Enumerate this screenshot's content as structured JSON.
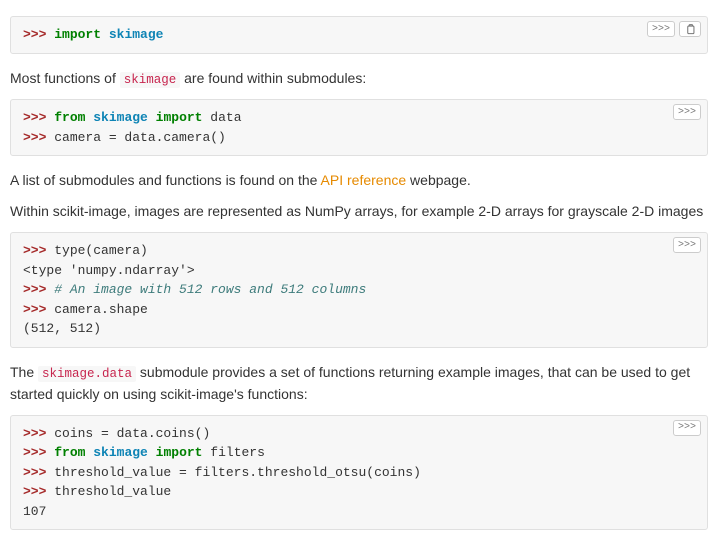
{
  "blocks": {
    "b1": {
      "l1_prompt": ">>> ",
      "l1_kw": "import",
      "l1_sp": " ",
      "l1_mod": "skimage"
    },
    "b2": {
      "l1_prompt": ">>> ",
      "l1_kw1": "from",
      "l1_sp1": " ",
      "l1_mod": "skimage",
      "l1_sp2": " ",
      "l1_kw2": "import",
      "l1_rest": " data",
      "l2_prompt": ">>> ",
      "l2_text": "camera = data.camera()"
    },
    "b3": {
      "l1_prompt": ">>> ",
      "l1_text": "type(camera)",
      "l2_out": "<type 'numpy.ndarray'>",
      "l3_prompt": ">>> ",
      "l3_comment": "# An image with 512 rows and 512 columns",
      "l4_prompt": ">>> ",
      "l4_text": "camera.shape",
      "l5_out": "(512, 512)"
    },
    "b4": {
      "l1_prompt": ">>> ",
      "l1_text": "coins = data.coins()",
      "l2_prompt": ">>> ",
      "l2_kw1": "from",
      "l2_sp1": " ",
      "l2_mod": "skimage",
      "l2_sp2": " ",
      "l2_kw2": "import",
      "l2_rest": " filters",
      "l3_prompt": ">>> ",
      "l3_text": "threshold_value = filters.threshold_otsu(coins)",
      "l4_prompt": ">>> ",
      "l4_text": "threshold_value",
      "l5_out": "107"
    }
  },
  "prose": {
    "p1_a": "Most functions of ",
    "p1_code": "skimage",
    "p1_b": " are found within submodules:",
    "p2_a": "A list of submodules and functions is found on the ",
    "p2_link": "API reference",
    "p2_b": " webpage.",
    "p3": "Within scikit-image, images are represented as NumPy arrays, for example 2-D arrays for grayscale 2-D images",
    "p4_a": "The ",
    "p4_code": "skimage.data",
    "p4_b": " submodule provides a set of functions returning example images, that can be used to get started quickly on using scikit-image's functions:"
  },
  "ui": {
    "toggle_label": ">>>"
  }
}
